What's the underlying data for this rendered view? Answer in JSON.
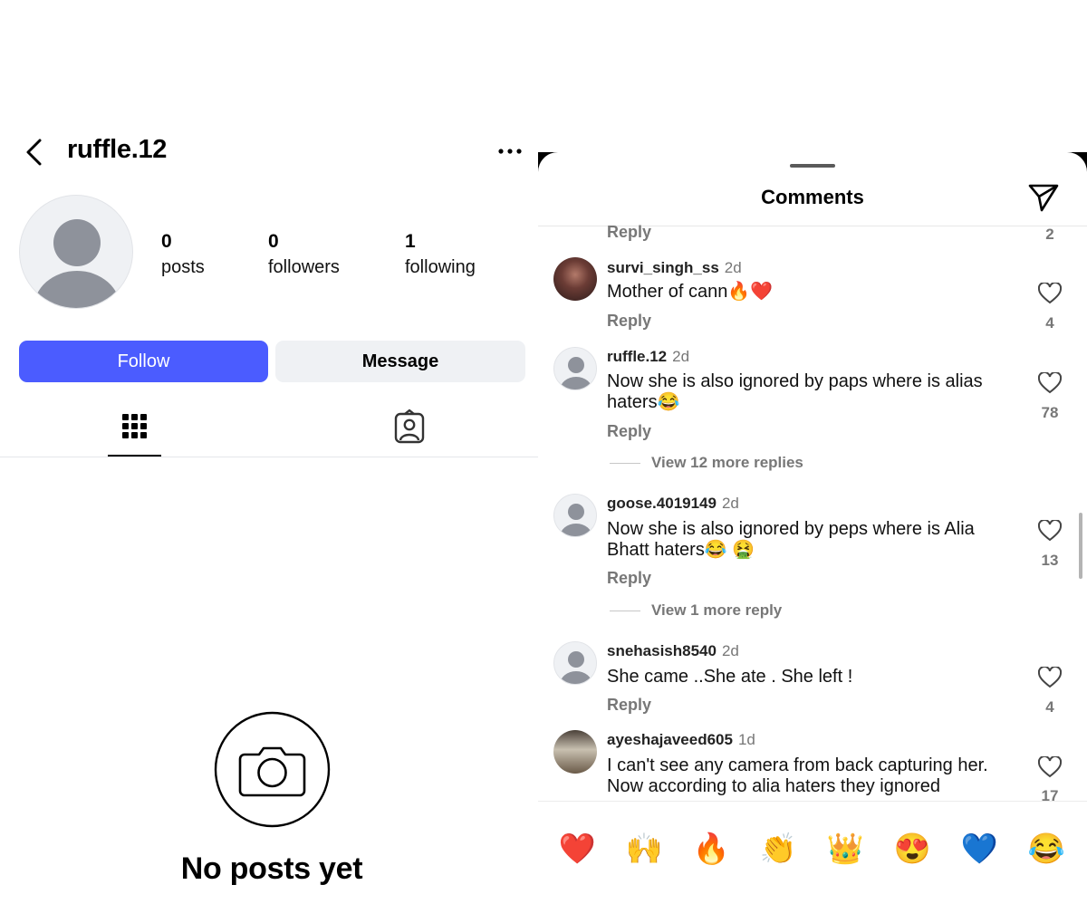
{
  "profile": {
    "username": "ruffle.12",
    "stats": [
      {
        "value": "0",
        "label": "posts"
      },
      {
        "value": "0",
        "label": "followers"
      },
      {
        "value": "1",
        "label": "following"
      }
    ],
    "follow_label": "Follow",
    "message_label": "Message",
    "empty_title": "No posts yet",
    "accent": "#4b5cff"
  },
  "comments_sheet": {
    "title": "Comments",
    "top_partial": {
      "reply": "Reply",
      "likes": "2"
    },
    "comments": [
      {
        "username": "survi_singh_ss",
        "time": "2d",
        "text": "Mother of cann🔥❤️",
        "reply": "Reply",
        "likes": "4"
      },
      {
        "username": "ruffle.12",
        "time": "2d",
        "text": "Now she is also ignored by paps where is alias haters😂",
        "reply": "Reply",
        "likes": "78",
        "view_more": "View 12 more replies"
      },
      {
        "username": "goose.4019149",
        "time": "2d",
        "text": "Now she is also ignored by peps where is Alia Bhatt haters😂 🤮",
        "reply": "Reply",
        "likes": "13",
        "view_more": "View 1 more reply"
      },
      {
        "username": "snehasish8540",
        "time": "2d",
        "text": "She came ..She ate . She left !",
        "reply": "Reply",
        "likes": "4"
      },
      {
        "username": "ayeshajaveed605",
        "time": "1d",
        "text": "I can't see any camera from back capturing her. Now according to alia haters they ignored",
        "likes": "17"
      }
    ],
    "quick_emojis": [
      "❤️",
      "🙌",
      "🔥",
      "👏",
      "👑",
      "😍",
      "💙",
      "😂"
    ]
  }
}
